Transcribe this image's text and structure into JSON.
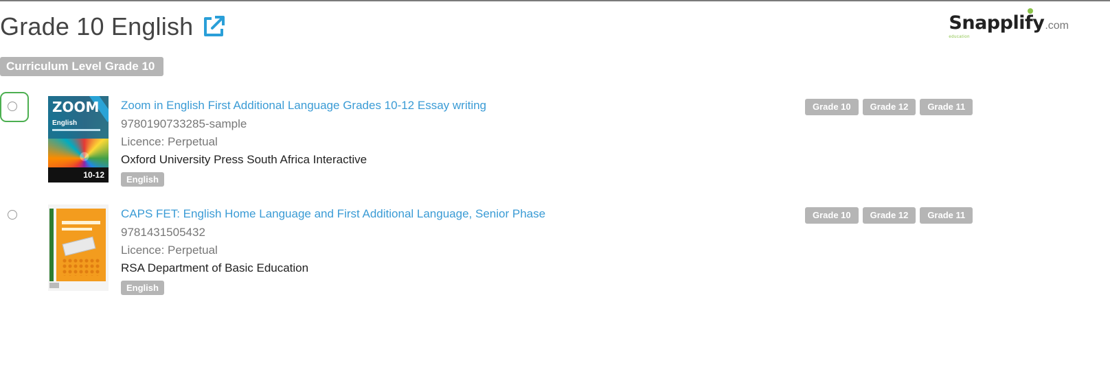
{
  "header": {
    "title": "Grade 10 English",
    "external_link_icon": "external-link-icon",
    "brand": {
      "name": "Snapplify",
      "domain": ".com",
      "tagline": "education"
    }
  },
  "curriculum": {
    "label": "Curriculum Level Grade 10"
  },
  "colors": {
    "link": "#3a9bd5",
    "badge": "#b5b5b5",
    "focus": "#4caf50",
    "brand_accent": "#8bc34a"
  },
  "books": [
    {
      "title": "Zoom in English First Additional Language Grades 10-12 Essay writing",
      "isbn": "9780190733285-sample",
      "licence": "Licence: Perpetual",
      "publisher": "Oxford University Press South Africa Interactive",
      "subject": "English",
      "grades": [
        "Grade 10",
        "Grade 12",
        "Grade 11"
      ],
      "cover": {
        "brand": "ZOOM",
        "subject": "English",
        "grades": "10-12"
      }
    },
    {
      "title": "CAPS FET: English Home Language and First Additional Language, Senior Phase",
      "isbn": "9781431505432",
      "licence": "Licence: Perpetual",
      "publisher": "RSA Department of Basic Education",
      "subject": "English",
      "grades": [
        "Grade 10",
        "Grade 12",
        "Grade 11"
      ]
    }
  ]
}
